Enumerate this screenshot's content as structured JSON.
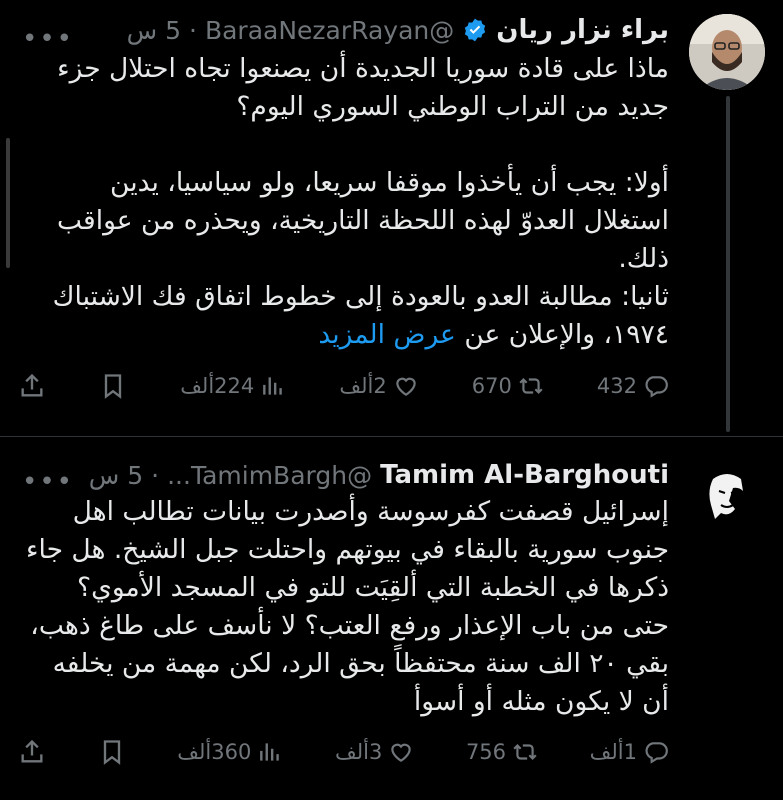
{
  "tweets": [
    {
      "name": "براء نزار ريان",
      "handle": "@BaraaNezarRayan",
      "time": "5 س",
      "dot": "·",
      "paragraphs": [
        "ماذا على قادة سوريا الجديدة أن يصنعوا تجاه احتلال جزء جديد من التراب الوطني السوري اليوم؟",
        "أولا: يجب أن يأخذوا موقفا سريعا، ولو سياسيا، يدين استغلال العدوّ لهذه اللحظة التاريخية، ويحذره من عواقب ذلك.",
        "ثانيا: مطالبة العدو بالعودة إلى خطوط اتفاق  فك الاشتباك ١٩٧٤، والإعلان عن"
      ],
      "show_more": "عرض المزيد",
      "stats": {
        "replies": "432",
        "retweets": "670",
        "likes": "2ألف",
        "views": "224ألف"
      }
    },
    {
      "name": "Tamim Al-Barghouti",
      "handle": "@TamimBargh...",
      "time": "5 س",
      "dot": "·",
      "text": "إسرائيل قصفت كفرسوسة وأصدرت بيانات تطالب اهل جنوب سورية بالبقاء في بيوتهم واحتلت جبل الشيخ. هل جاء ذكرها في الخطبة التي ألقِيَت للتو في المسجد الأموي؟ حتى من باب الإعذار ورفع العتب؟ لا نأسف على طاغ ذهب، بقي ٢٠ الف سنة محتفظاً بحق الرد، لكن مهمة من يخلفه أن لا يكون مثله أو أسوأ",
      "stats": {
        "replies": "1ألف",
        "retweets": "756",
        "likes": "3ألف",
        "views": "360ألف"
      }
    }
  ],
  "colors": {
    "background": "#000000",
    "text": "#e7e9ea",
    "muted": "#71767b",
    "link": "#1d9bf0",
    "verified": "#1d9bf0"
  }
}
